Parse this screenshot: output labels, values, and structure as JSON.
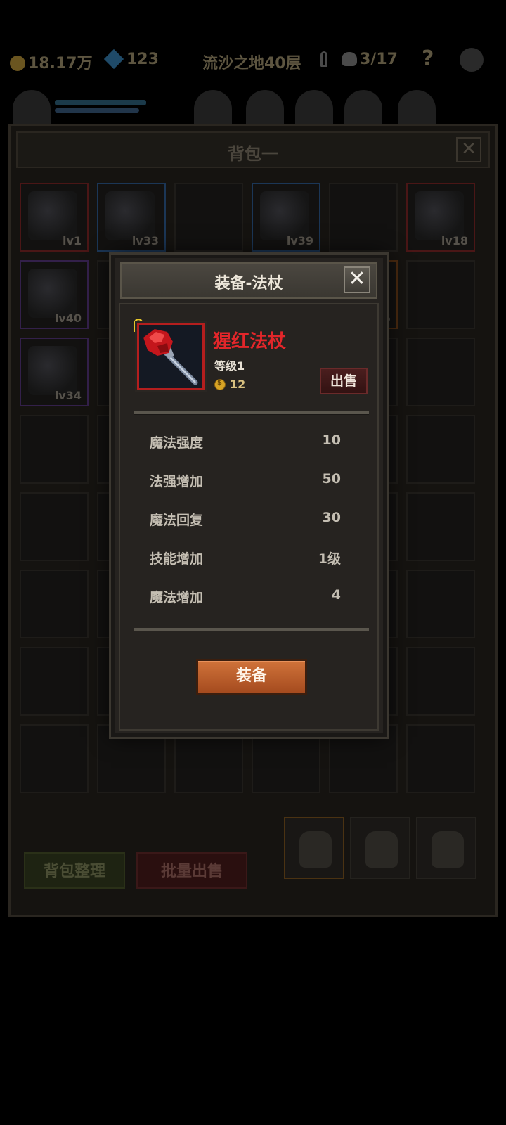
{
  "topbar": {
    "gold": "18.17万",
    "gems": "123",
    "location": "流沙之地40层",
    "progress": "3/17",
    "help": "?"
  },
  "backpack": {
    "title": "背包一",
    "close": "✕",
    "slots": [
      {
        "level": "lv1",
        "rarity": "red"
      },
      {
        "level": "lv33",
        "rarity": "blue"
      },
      {
        "level": "",
        "rarity": "none"
      },
      {
        "level": "lv39",
        "rarity": "blue"
      },
      {
        "level": "",
        "rarity": "none"
      },
      {
        "level": "lv18",
        "rarity": "red"
      },
      {
        "level": "lv40",
        "rarity": "purple"
      },
      {
        "level": "5",
        "rarity": "orange"
      },
      {
        "level": "lv34",
        "rarity": "purple"
      }
    ],
    "sort_button": "背包整理",
    "batch_sell_button": "批量出售"
  },
  "modal": {
    "title": "装备-法杖",
    "close": "✕",
    "item_name": "猩红法杖",
    "item_level": "等级1",
    "price": "12",
    "sell_button": "出售",
    "stats": [
      {
        "name": "魔法强度",
        "value": "10"
      },
      {
        "name": "法强增加",
        "value": "50"
      },
      {
        "name": "魔法回复",
        "value": "30"
      },
      {
        "name": "技能增加",
        "value": "1级"
      },
      {
        "name": "魔法增加",
        "value": "4"
      }
    ],
    "equip_button": "装备"
  },
  "colors": {
    "item_name": "#e2262a",
    "equip_button": "#c0622e",
    "rarity_red": "#b41e1e"
  }
}
